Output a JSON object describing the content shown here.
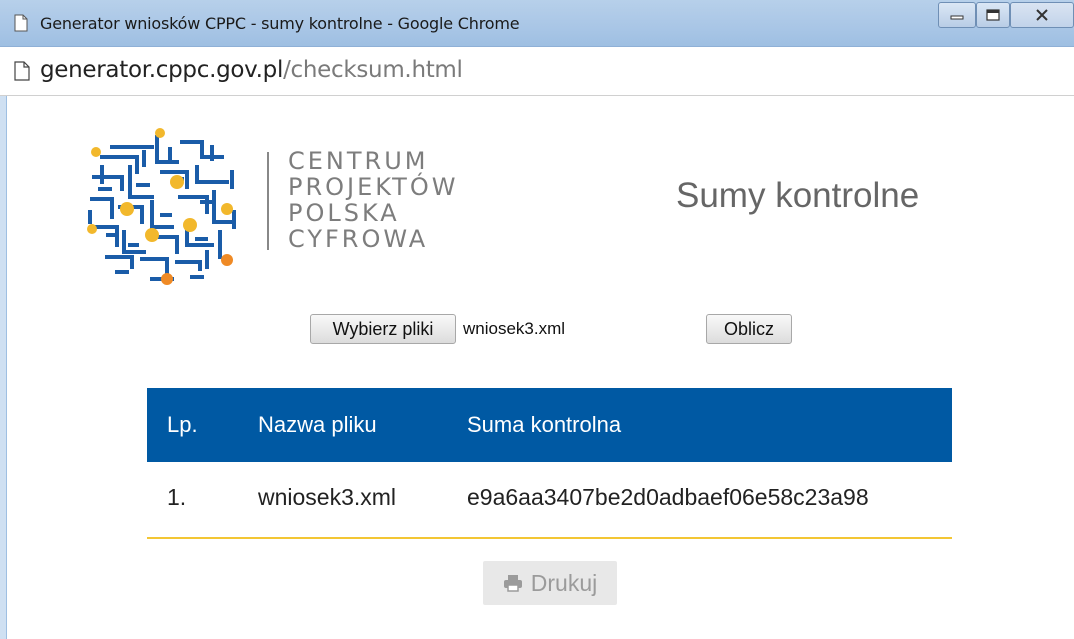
{
  "window": {
    "title": "Generator wniosków CPPC - sumy kontrolne - Google Chrome",
    "controls": [
      "minimize-icon",
      "maximize-icon",
      "close-icon"
    ]
  },
  "addressbar": {
    "domain": "generator.cppc.gov.pl",
    "path": "/checksum.html"
  },
  "logo": {
    "lines": [
      "CENTRUM",
      "PROJEKTÓW",
      "POLSKA",
      "CYFROWA"
    ],
    "colors": {
      "blue": "#1a5ca8",
      "yellow": "#f2b82c",
      "orange": "#ef8a25"
    }
  },
  "page": {
    "title": "Sumy kontrolne"
  },
  "form": {
    "choose_label": "Wybierz pliki",
    "filename": "wniosek3.xml",
    "calc_label": "Oblicz"
  },
  "table": {
    "headers": [
      "Lp.",
      "Nazwa pliku",
      "Suma kontrolna"
    ],
    "rows": [
      [
        "1.",
        "wniosek3.xml",
        "e9a6aa3407be2d0adbaef06e58c23a98"
      ]
    ],
    "header_color": "#0059a3",
    "rule_color": "#f3c634"
  },
  "print": {
    "label": "Drukuj",
    "icon": "printer-icon"
  }
}
